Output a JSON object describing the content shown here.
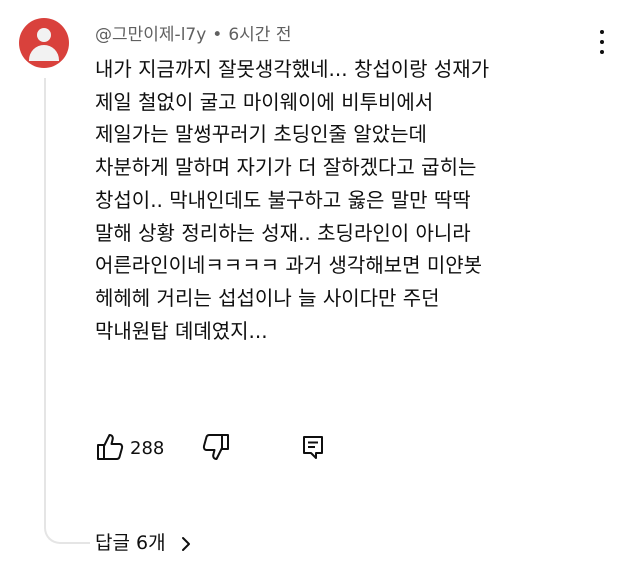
{
  "comment": {
    "author": "@그만이제-l7y",
    "separator": "•",
    "timestamp": "6시간 전",
    "lines": [
      "내가 지금까지 잘못생각했네... 창섭이랑 성재가",
      "제일 철없이 굴고 마이웨이에 비투비에서",
      "제일가는 말썽꾸러기 초딩인줄 알았는데",
      "차분하게 말하며 자기가 더 잘하겠다고 굽히는",
      "창섭이.. 막내인데도 불구하고 옳은 말만 딱딱",
      "말해 상황 정리하는 성재.. 초딩라인이 아니라",
      "어른라인이네ㅋㅋㅋㅋ 과거 생각해보면 미얀봇",
      "헤헤헤 거리는 섭섭이나 늘 사이다만 주던",
      "막내원탑 뎨뎨였지..."
    ],
    "like_count": "288",
    "replies_label": "답글 6개"
  },
  "icons": {
    "avatar": "avatar-icon",
    "menu": "more-vert-icon",
    "like": "thumb-up-icon",
    "dislike": "thumb-down-icon",
    "reply": "reply-comment-icon",
    "expand": "chevron-right-icon"
  },
  "colors": {
    "avatar_bg": "#d9413c",
    "text_primary": "#0f0f0f",
    "text_secondary": "#606060",
    "thread_line": "#e5e5e5"
  }
}
